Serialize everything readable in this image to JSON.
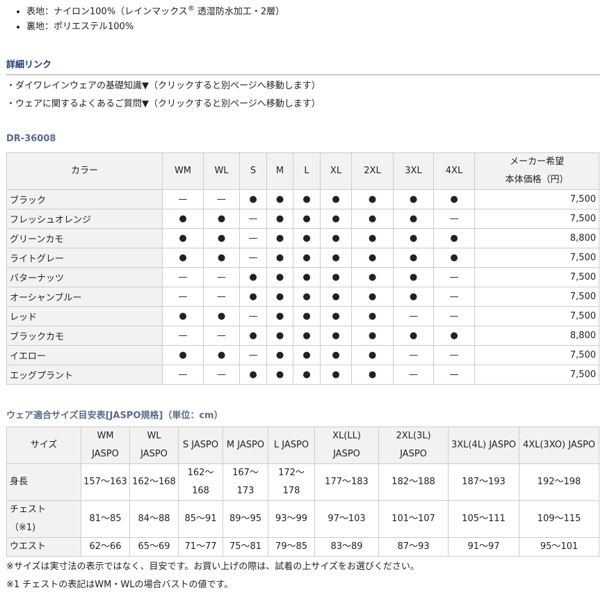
{
  "material": {
    "outer_prefix": "表地：ナイロン100%（レインマックス",
    "outer_sup": "®",
    "outer_suffix": " 透湿防水加工・2層）",
    "lining": "裏地：ポリエステル100%"
  },
  "detail_links": {
    "heading": "詳細リンク",
    "items": [
      "・ダイワレインウェアの基礎知識▼（クリックすると別ページへ移動します）",
      "・ウェアに関するよくあるご質問▼（クリックすると別ページへ移動します）"
    ]
  },
  "model": {
    "heading": "DR-36008",
    "header_color": "カラー",
    "header_sizes": [
      "WM",
      "WL",
      "S",
      "M",
      "L",
      "XL",
      "2XL",
      "3XL",
      "4XL"
    ],
    "header_price_line1": "メーカー希望",
    "header_price_line2": "本体価格（円）",
    "rows": [
      {
        "color": "ブラック",
        "avail": [
          "—",
          "—",
          "●",
          "●",
          "●",
          "●",
          "●",
          "●",
          "●"
        ],
        "price": "7,500"
      },
      {
        "color": "フレッシュオレンジ",
        "avail": [
          "●",
          "●",
          "—",
          "●",
          "●",
          "●",
          "●",
          "●",
          "—"
        ],
        "price": "7,500"
      },
      {
        "color": "グリーンカモ",
        "avail": [
          "●",
          "●",
          "—",
          "●",
          "●",
          "●",
          "●",
          "●",
          "●"
        ],
        "price": "8,800"
      },
      {
        "color": "ライトグレー",
        "avail": [
          "●",
          "●",
          "—",
          "●",
          "●",
          "●",
          "●",
          "●",
          "●"
        ],
        "price": "7,500"
      },
      {
        "color": "バターナッツ",
        "avail": [
          "—",
          "—",
          "●",
          "●",
          "●",
          "●",
          "●",
          "●",
          "—"
        ],
        "price": "7,500"
      },
      {
        "color": "オーシャンブルー",
        "avail": [
          "—",
          "—",
          "●",
          "●",
          "●",
          "●",
          "●",
          "●",
          "—"
        ],
        "price": "7,500"
      },
      {
        "color": "レッド",
        "avail": [
          "●",
          "●",
          "—",
          "●",
          "●",
          "●",
          "●",
          "—",
          "—"
        ],
        "price": "7,500"
      },
      {
        "color": "ブラックカモ",
        "avail": [
          "—",
          "—",
          "●",
          "●",
          "●",
          "●",
          "●",
          "●",
          "●"
        ],
        "price": "8,800"
      },
      {
        "color": "イエロー",
        "avail": [
          "●",
          "●",
          "—",
          "●",
          "●",
          "●",
          "●",
          "—",
          "—"
        ],
        "price": "7,500"
      },
      {
        "color": "エッグプラント",
        "avail": [
          "—",
          "—",
          "●",
          "●",
          "●",
          "●",
          "●",
          "—",
          "—"
        ],
        "price": "7,500"
      }
    ]
  },
  "size_chart": {
    "heading": "ウェア適合サイズ目安表[JASPO規格]（単位：cm）",
    "header_label": "サイズ",
    "headers": [
      [
        "WM",
        "JASPO"
      ],
      [
        "WL",
        "JASPO"
      ],
      [
        "S JASPO"
      ],
      [
        "M JASPO"
      ],
      [
        "L JASPO"
      ],
      [
        "XL(LL)",
        "JASPO"
      ],
      [
        "2XL(3L)",
        "JASPO"
      ],
      [
        "3XL(4L) JASPO"
      ],
      [
        "4XL(3XO) JASPO"
      ]
    ],
    "rows": [
      {
        "label": [
          "身長"
        ],
        "values": [
          [
            "157〜163"
          ],
          [
            "162〜168"
          ],
          [
            "162〜",
            "168"
          ],
          [
            "167〜",
            "173"
          ],
          [
            "172〜",
            "178"
          ],
          [
            "177〜183"
          ],
          [
            "182〜188"
          ],
          [
            "187〜193"
          ],
          [
            "192〜198"
          ]
        ]
      },
      {
        "label": [
          "チェスト",
          "（※1)"
        ],
        "values": [
          [
            "81〜85"
          ],
          [
            "84〜88"
          ],
          [
            "85〜91"
          ],
          [
            "89〜95"
          ],
          [
            "93〜99"
          ],
          [
            "97〜103"
          ],
          [
            "101〜107"
          ],
          [
            "105〜111"
          ],
          [
            "109〜115"
          ]
        ]
      },
      {
        "label": [
          "ウエスト"
        ],
        "values": [
          [
            "62〜66"
          ],
          [
            "65〜69"
          ],
          [
            "71〜77"
          ],
          [
            "75〜81"
          ],
          [
            "79〜85"
          ],
          [
            "83〜89"
          ],
          [
            "87〜93"
          ],
          [
            "91〜97"
          ],
          [
            "95〜101"
          ]
        ]
      }
    ]
  },
  "notes": [
    "※サイズは実寸法の表示ではなく、目安です。お買い上げの際は、試着の上サイズをお選びください。",
    "※1 チェストの表記はWM・WLの場合バストの値です。"
  ]
}
